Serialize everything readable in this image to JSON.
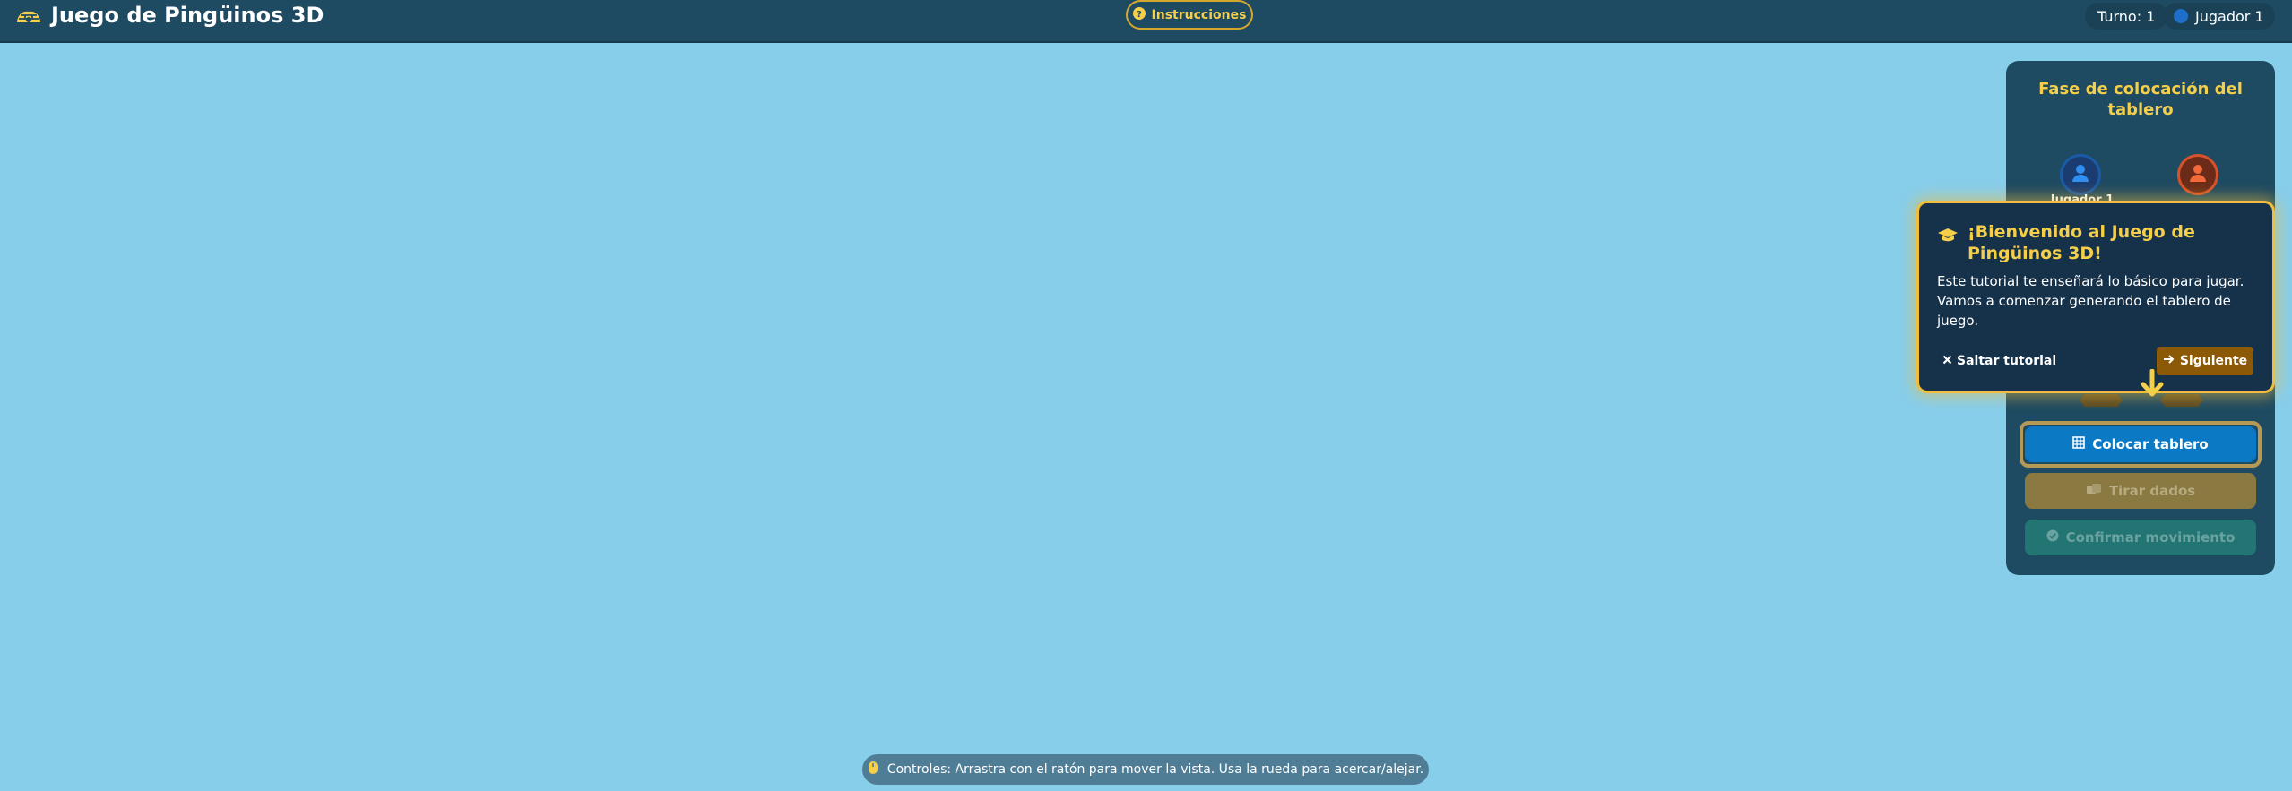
{
  "header": {
    "title": "Juego de Pingüinos 3D",
    "logo_icon": "igloo-icon",
    "instructions_label": "Instrucciones",
    "turn_text": "Turno: 1",
    "current_player": "Jugador 1",
    "current_player_color": "#1e6fc9"
  },
  "panel": {
    "phase_title": "Fase de colocación del tablero",
    "players": [
      {
        "label": "Jugador 1",
        "color": "#1b5aa5"
      },
      {
        "color": "#d5522a"
      }
    ],
    "actions": {
      "place_board": "Colocar tablero",
      "roll_dice": "Tirar dados",
      "confirm_move": "Confirmar movimiento"
    }
  },
  "tutorial": {
    "title": "¡Bienvenido al Juego de Pingüinos 3D!",
    "body": "Este tutorial te enseñará lo básico para jugar. Vamos a comenzar generando el tablero de juego.",
    "skip_label": "Saltar tutorial",
    "next_label": "Siguiente"
  },
  "controls_hint": "Controles: Arrastra con el ratón para mover la vista. Usa la rueda para acercar/alejar.",
  "colors": {
    "scene_background": "#87ceeb",
    "header_background": "#1e4a62",
    "accent_gold": "#f6cf4a",
    "primary_blue": "#0b79c4"
  }
}
